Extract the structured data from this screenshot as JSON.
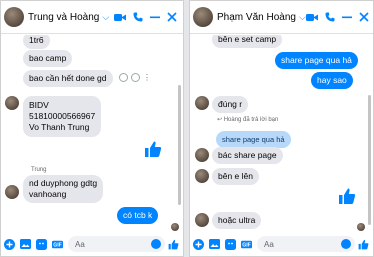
{
  "chat1": {
    "title": "Trung và Hoàng",
    "messages": {
      "m1": "1tr6",
      "m2": "bao camp",
      "m3": "bao cần hết done gd",
      "bidv1": "BIDV",
      "bidv2": "51810000566967",
      "bidv3": "Vo Thanh Trung",
      "sender": "Trung",
      "m5a": "nd duyphong gdtg",
      "m5b": "vanhoang",
      "out1": "có tcb k"
    },
    "input_placeholder": "Aa"
  },
  "chat2": {
    "title": "Phạm Văn Hoàng",
    "messages": {
      "m1": "bên e set camp",
      "out1": "share page qua hả",
      "out2": "hay sao",
      "m2": "đúng r",
      "reply_note": "Hoàng đã trả lời bạn",
      "reply_quote": "share page qua hả",
      "m3": "bác share page",
      "m4": "bên e lên",
      "m5": "hoặc ultra"
    },
    "input_placeholder": "Aa"
  },
  "colors": {
    "accent": "#0084ff",
    "incoming": "#e4e6eb"
  }
}
